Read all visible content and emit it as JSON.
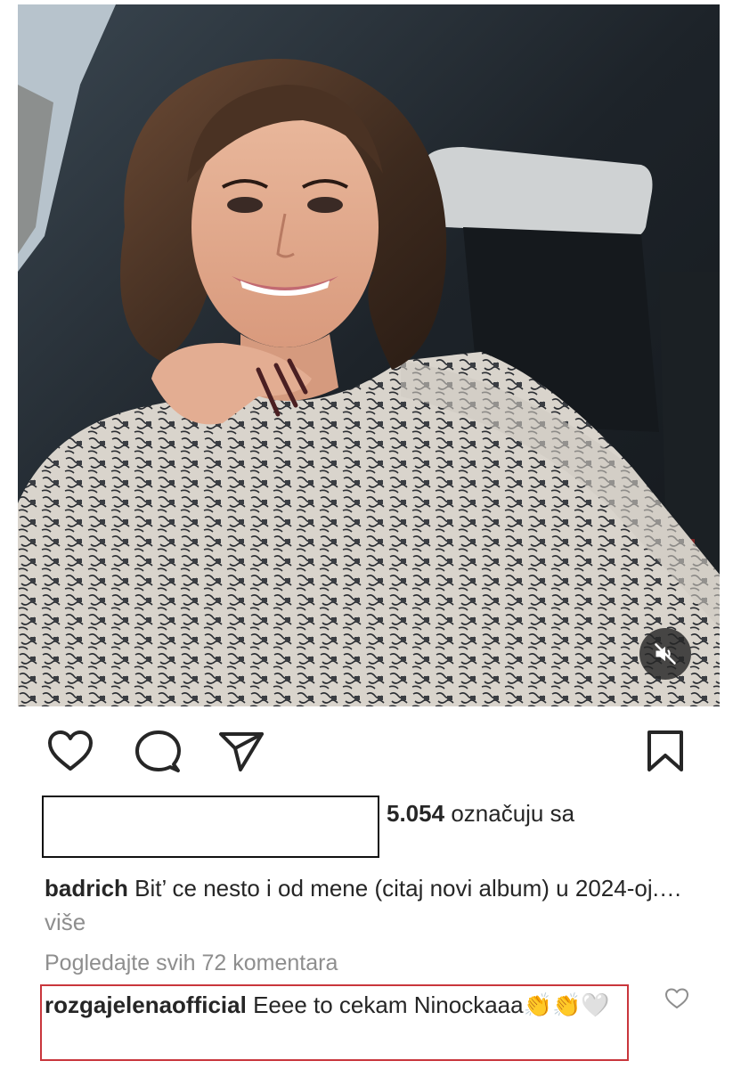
{
  "post": {
    "media_alt": "selfie in car",
    "mute_icon": "speaker-muted-icon"
  },
  "actions": {
    "like_icon": "heart-outline-icon",
    "comment_icon": "speech-bubble-icon",
    "share_icon": "paper-plane-icon",
    "save_icon": "bookmark-icon"
  },
  "likes": {
    "count": "5.054",
    "suffix": "označuju sa"
  },
  "caption": {
    "username": "badrich",
    "text": "Bit’ ce nesto i od mene (citaj novi album) u 2024-oj.…",
    "more": "više"
  },
  "comments_link": "Pogledajte svih 72 komentara",
  "comment": {
    "username": "rozgajelenaofficial",
    "text": "Eeee to cekam Ninockaaa",
    "emojis": "👏👏🤍"
  },
  "colors": {
    "highlight": "#c9363c",
    "muted_text": "#8e8e8e",
    "text": "#262626"
  }
}
